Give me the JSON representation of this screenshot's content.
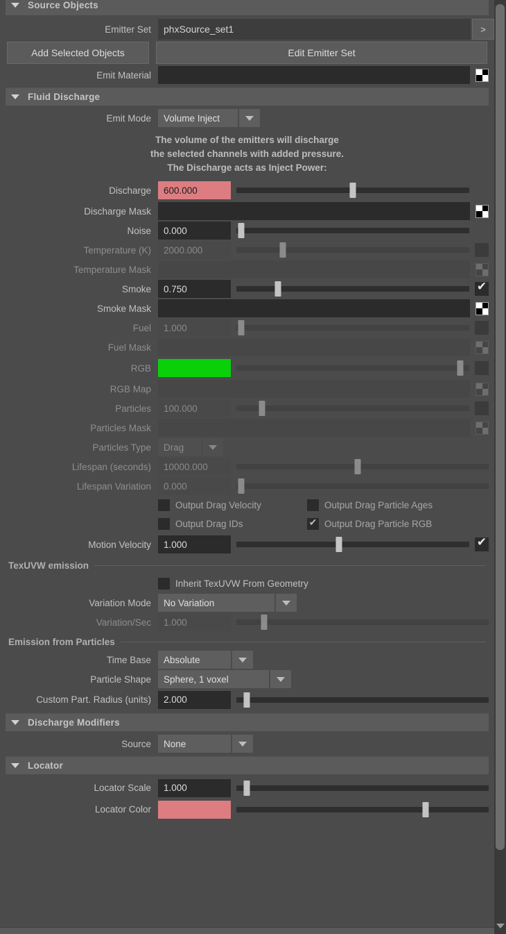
{
  "panel": {
    "sections": [
      {
        "id": "source_objects",
        "title": "Source Objects"
      },
      {
        "id": "fluid_discharge",
        "title": "Fluid Discharge"
      },
      {
        "id": "discharge_modifiers",
        "title": "Discharge Modifiers"
      },
      {
        "id": "locator",
        "title": "Locator"
      }
    ]
  },
  "source_objects": {
    "emitter_set_label": "Emitter Set",
    "emitter_set_value": "phxSource_set1",
    "emitter_set_browse": ">",
    "add_selected_objects": "Add Selected Objects",
    "edit_emitter_set": "Edit Emitter Set",
    "emit_material_label": "Emit Material",
    "emit_material_value": ""
  },
  "fluid_discharge": {
    "emit_mode_label": "Emit Mode",
    "emit_mode_value": "Volume Inject",
    "info_line1": "The volume of the emitters will discharge",
    "info_line2": "the selected channels with added pressure.",
    "info_line3": "The Discharge acts as Inject Power:",
    "rows": [
      {
        "label": "Discharge",
        "value": "600.000",
        "slider": 50,
        "disabled": false,
        "field": "pink",
        "right": "none"
      },
      {
        "label": "Discharge Mask",
        "value": "",
        "slider": null,
        "disabled": false,
        "field": "map",
        "right": "checker"
      },
      {
        "label": "Noise",
        "value": "0.000",
        "slider": 2,
        "disabled": false,
        "field": "num",
        "right": "none"
      },
      {
        "label": "Temperature (K)",
        "value": "2000.000",
        "slider": 20,
        "disabled": true,
        "field": "num",
        "right": "checkbox",
        "checked": false
      },
      {
        "label": "Temperature Mask",
        "value": "",
        "slider": null,
        "disabled": true,
        "field": "map",
        "right": "checker"
      },
      {
        "label": "Smoke",
        "value": "0.750",
        "slider": 18,
        "disabled": false,
        "field": "num",
        "right": "checkbox",
        "checked": true
      },
      {
        "label": "Smoke Mask",
        "value": "",
        "slider": null,
        "disabled": false,
        "field": "map",
        "right": "checker"
      },
      {
        "label": "Fuel",
        "value": "1.000",
        "slider": 2,
        "disabled": true,
        "field": "num",
        "right": "checkbox",
        "checked": false
      },
      {
        "label": "Fuel Mask",
        "value": "",
        "slider": null,
        "disabled": true,
        "field": "map",
        "right": "checker"
      },
      {
        "label": "RGB",
        "value": "",
        "slider": 96,
        "disabled": true,
        "field": "green",
        "right": "checkbox",
        "checked": false
      },
      {
        "label": "RGB Map",
        "value": "",
        "slider": null,
        "disabled": true,
        "field": "map",
        "right": "checker"
      },
      {
        "label": "Particles",
        "value": "100.000",
        "slider": 11,
        "disabled": true,
        "field": "num",
        "right": "checkbox",
        "checked": false
      },
      {
        "label": "Particles Mask",
        "value": "",
        "slider": null,
        "disabled": true,
        "field": "map",
        "right": "checker"
      }
    ],
    "particles_type_label": "Particles Type",
    "particles_type_value": "Drag",
    "lifespan_label": "Lifespan (seconds)",
    "lifespan_value": "10000.000",
    "lifespan_slider": 48,
    "lifespan_variation_label": "Lifespan Variation",
    "lifespan_variation_value": "0.000",
    "lifespan_variation_slider": 2,
    "checkboxes": [
      {
        "label": "Output Drag Velocity",
        "checked": false
      },
      {
        "label": "Output Drag Particle Ages",
        "checked": false
      },
      {
        "label": "Output Drag IDs",
        "checked": false
      },
      {
        "label": "Output Drag Particle RGB",
        "checked": true
      }
    ],
    "motion_velocity_label": "Motion Velocity",
    "motion_velocity_value": "1.000",
    "motion_velocity_slider": 44,
    "motion_velocity_checked": true,
    "texuvw_group": "TexUVW emission",
    "inherit_texuvw_label": "Inherit TexUVW From Geometry",
    "inherit_texuvw_checked": false,
    "variation_mode_label": "Variation Mode",
    "variation_mode_value": "No Variation",
    "variation_sec_label": "Variation/Sec",
    "variation_sec_value": "1.000",
    "variation_sec_slider": 11,
    "emission_particles_group": "Emission from Particles",
    "time_base_label": "Time Base",
    "time_base_value": "Absolute",
    "particle_shape_label": "Particle Shape",
    "particle_shape_value": "Sphere, 1 voxel",
    "custom_radius_label": "Custom Part. Radius (units)",
    "custom_radius_value": "2.000",
    "custom_radius_slider": 4
  },
  "discharge_modifiers": {
    "source_label": "Source",
    "source_value": "None"
  },
  "locator": {
    "scale_label": "Locator Scale",
    "scale_value": "1.000",
    "scale_slider": 4,
    "color_label": "Locator Color",
    "color_value": "",
    "color_slider": 75
  },
  "icons": {
    "collapse": "collapse-triangle-icon",
    "dropdown": "chevron-down-icon",
    "checker": "checker-map-icon",
    "check": "✔",
    "scroll_down": "scroll-down-arrow-icon"
  },
  "colors": {
    "discharge_field": "#dd7d82",
    "rgb_swatch": "#0ad00a",
    "locator_color": "#dd7d82",
    "panel_bg": "#4b4b4b",
    "header_bg": "#5b5b5b"
  }
}
